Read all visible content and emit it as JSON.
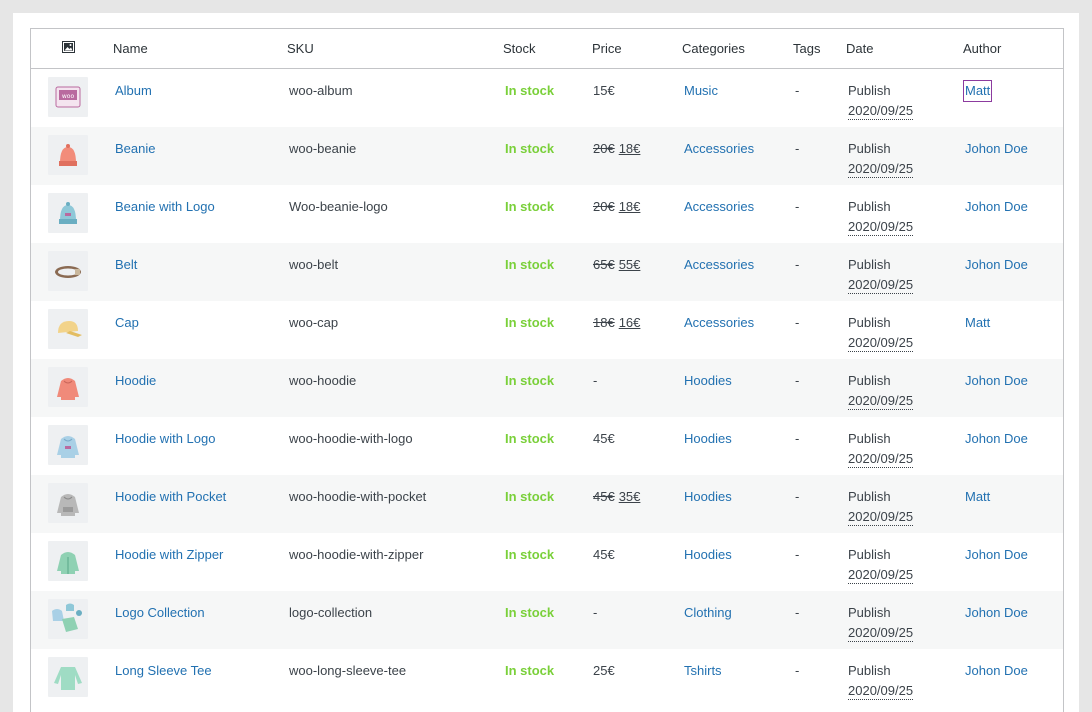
{
  "columns": {
    "image_icon": "image-icon",
    "name": "Name",
    "sku": "SKU",
    "stock": "Stock",
    "price": "Price",
    "categories": "Categories",
    "tags": "Tags",
    "date": "Date",
    "author": "Author"
  },
  "colors": {
    "link": "#2271b1",
    "in_stock": "#7ad03a",
    "row_alt": "#f6f7f7",
    "border": "#c3c4c7"
  },
  "rows": [
    {
      "name": "Album",
      "sku": "woo-album",
      "stock": "In stock",
      "price": "15€",
      "price_old": "",
      "price_new": "",
      "category": "Music",
      "tags": "-",
      "status": "Publish",
      "date": "2020/09/25",
      "author": "Matt",
      "thumb": "album-thumbnail"
    },
    {
      "name": "Beanie",
      "sku": "woo-beanie",
      "stock": "In stock",
      "price": "",
      "price_old": "20€",
      "price_new": "18€",
      "category": "Accessories",
      "tags": "-",
      "status": "Publish",
      "date": "2020/09/25",
      "author": "Johon Doe",
      "thumb": "beanie-thumbnail"
    },
    {
      "name": "Beanie with Logo",
      "sku": "Woo-beanie-logo",
      "stock": "In stock",
      "price": "",
      "price_old": "20€",
      "price_new": "18€",
      "category": "Accessories",
      "tags": "-",
      "status": "Publish",
      "date": "2020/09/25",
      "author": "Johon Doe",
      "thumb": "beanie-logo-thumbnail"
    },
    {
      "name": "Belt",
      "sku": "woo-belt",
      "stock": "In stock",
      "price": "",
      "price_old": "65€",
      "price_new": "55€",
      "category": "Accessories",
      "tags": "-",
      "status": "Publish",
      "date": "2020/09/25",
      "author": "Johon Doe",
      "thumb": "belt-thumbnail"
    },
    {
      "name": "Cap",
      "sku": "woo-cap",
      "stock": "In stock",
      "price": "",
      "price_old": "18€",
      "price_new": "16€",
      "category": "Accessories",
      "tags": "-",
      "status": "Publish",
      "date": "2020/09/25",
      "author": "Matt",
      "thumb": "cap-thumbnail"
    },
    {
      "name": "Hoodie",
      "sku": "woo-hoodie",
      "stock": "In stock",
      "price": "-",
      "price_old": "",
      "price_new": "",
      "category": "Hoodies",
      "tags": "-",
      "status": "Publish",
      "date": "2020/09/25",
      "author": "Johon Doe",
      "thumb": "hoodie-thumbnail"
    },
    {
      "name": "Hoodie with Logo",
      "sku": "woo-hoodie-with-logo",
      "stock": "In stock",
      "price": "45€",
      "price_old": "",
      "price_new": "",
      "category": "Hoodies",
      "tags": "-",
      "status": "Publish",
      "date": "2020/09/25",
      "author": "Johon Doe",
      "thumb": "hoodie-logo-thumbnail"
    },
    {
      "name": "Hoodie with Pocket",
      "sku": "woo-hoodie-with-pocket",
      "stock": "In stock",
      "price": "",
      "price_old": "45€",
      "price_new": "35€",
      "category": "Hoodies",
      "tags": "-",
      "status": "Publish",
      "date": "2020/09/25",
      "author": "Matt",
      "thumb": "hoodie-pocket-thumbnail"
    },
    {
      "name": "Hoodie with Zipper",
      "sku": "woo-hoodie-with-zipper",
      "stock": "In stock",
      "price": "45€",
      "price_old": "",
      "price_new": "",
      "category": "Hoodies",
      "tags": "-",
      "status": "Publish",
      "date": "2020/09/25",
      "author": "Johon Doe",
      "thumb": "hoodie-zipper-thumbnail"
    },
    {
      "name": "Logo Collection",
      "sku": "logo-collection",
      "stock": "In stock",
      "price": "-",
      "price_old": "",
      "price_new": "",
      "category": "Clothing",
      "tags": "-",
      "status": "Publish",
      "date": "2020/09/25",
      "author": "Johon Doe",
      "thumb": "logo-collection-thumbnail"
    },
    {
      "name": "Long Sleeve Tee",
      "sku": "woo-long-sleeve-tee",
      "stock": "In stock",
      "price": "25€",
      "price_old": "",
      "price_new": "",
      "category": "Tshirts",
      "tags": "-",
      "status": "Publish",
      "date": "2020/09/25",
      "author": "Johon Doe",
      "thumb": "long-sleeve-tee-thumbnail"
    }
  ]
}
